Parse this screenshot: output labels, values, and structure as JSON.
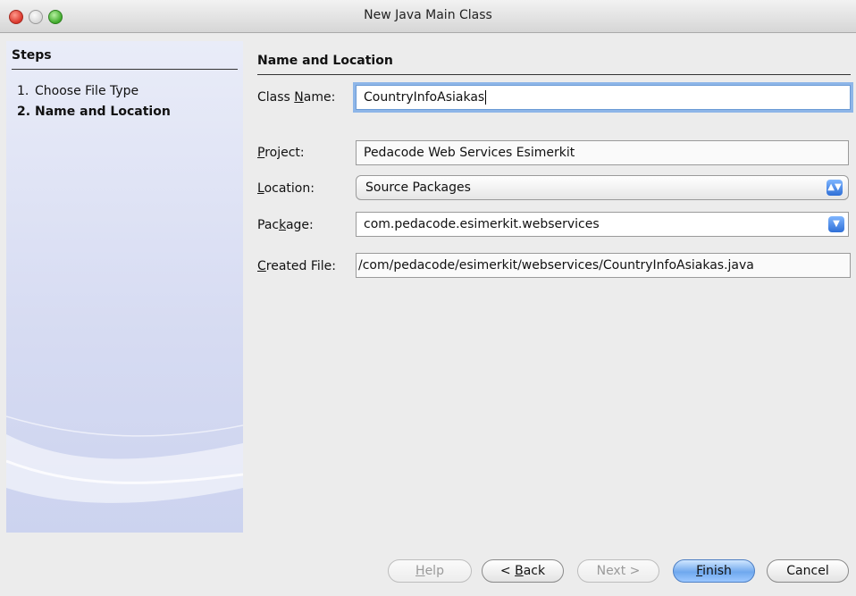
{
  "window": {
    "title": "New Java Main Class"
  },
  "sidebar": {
    "title": "Steps",
    "steps": [
      {
        "num": "1.",
        "label": "Choose File Type"
      },
      {
        "num": "2.",
        "label": "Name and Location"
      }
    ]
  },
  "panel": {
    "title": "Name and Location",
    "class_name": {
      "label_pre": "Class ",
      "label_mn": "N",
      "label_post": "ame:",
      "value": "CountryInfoAsiakas"
    },
    "project": {
      "label_mn": "P",
      "label_post": "roject:",
      "value": "Pedacode Web Services Esimerkit"
    },
    "location": {
      "label_mn": "L",
      "label_post": "ocation:",
      "value": "Source Packages"
    },
    "package": {
      "label_pre": "Pac",
      "label_mn": "k",
      "label_post": "age:",
      "value": "com.pedacode.esimerkit.webservices"
    },
    "created_file": {
      "label_mn": "C",
      "label_post": "reated File:",
      "value": "/com/pedacode/esimerkit/webservices/CountryInfoAsiakas.java"
    }
  },
  "buttons": {
    "help": {
      "mn": "H",
      "post": "elp"
    },
    "back": {
      "pre": "< ",
      "mn": "B",
      "post": "ack"
    },
    "next": "Next >",
    "finish": {
      "mn": "F",
      "post": "inish"
    },
    "cancel": "Cancel"
  }
}
